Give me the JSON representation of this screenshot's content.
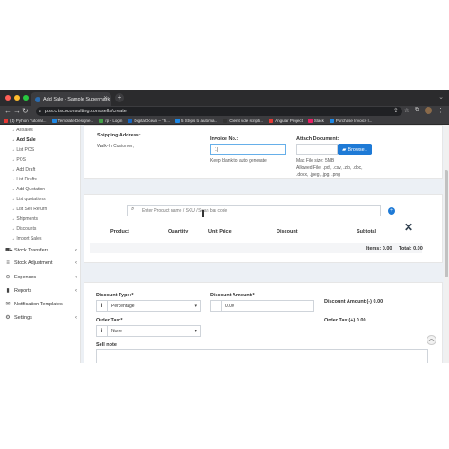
{
  "browser": {
    "tab_title": "Add Sale - Sample Supermark",
    "url": "pos.criscoconsulting.com/sells/create",
    "bookmarks": [
      {
        "label": "(1) Python Tutorial...",
        "color": "#e53935"
      },
      {
        "label": "Template Designe...",
        "color": "#1e88e5"
      },
      {
        "label": "rp - Login",
        "color": "#43a047"
      },
      {
        "label": "DigitalOcean – Th...",
        "color": "#1565c0"
      },
      {
        "label": "5 Steps to automa...",
        "color": "#1e88e5"
      },
      {
        "label": "Client side scripti...",
        "color": "#333333"
      },
      {
        "label": "Angular Project",
        "color": "#e53935"
      },
      {
        "label": "Slack",
        "color": "#e91e63"
      },
      {
        "label": "Purchase Invoice l...",
        "color": "#1e88e5"
      }
    ]
  },
  "sidebar": {
    "sub_items": [
      "→ All sales",
      "→ Add Sale",
      "→ List POS",
      "→ POS",
      "→ Add Draft",
      "→ List Drafts",
      "→ Add Quotation",
      "→ List quotations",
      "→ List Sell Return",
      "→ Shipments",
      "→ Discounts",
      "→ Import Sales"
    ],
    "active_index": 1,
    "main_items": [
      {
        "label": "Stock Transfers",
        "icon": "truck-icon",
        "glyph": "⛟",
        "has_chevron": true
      },
      {
        "label": "Stock Adjustment",
        "icon": "database-icon",
        "glyph": "≡",
        "has_chevron": true
      },
      {
        "label": "Expenses",
        "icon": "minus-circle-icon",
        "glyph": "⊖",
        "has_chevron": true
      },
      {
        "label": "Reports",
        "icon": "chart-icon",
        "glyph": "▮",
        "has_chevron": true
      },
      {
        "label": "Notification Templates",
        "icon": "envelope-icon",
        "glyph": "✉",
        "has_chevron": false
      },
      {
        "label": "Settings",
        "icon": "gear-icon",
        "glyph": "⚙",
        "has_chevron": true
      }
    ]
  },
  "top_card": {
    "shipping_label": "Shipping Address:",
    "customer": "Walk-In Customer,",
    "invoice_label": "Invoice No.:",
    "invoice_value": "1|",
    "invoice_help": "Keep blank to auto generate",
    "attach_label": "Attach Document:",
    "browse_label": "Browse..",
    "max_size": "Max File size: 5MB",
    "allowed_line1": "Allowed File: .pdf, .csv, .zip, .doc,",
    "allowed_line2": ".docx, .jpeg, .jpg, .png"
  },
  "products": {
    "search_placeholder": "Enter Product name / SKU / Scan bar code",
    "headers": [
      "Product",
      "Quantity",
      "Unit Price",
      "Discount",
      "Subtotal"
    ],
    "items_text": "Items: 0.00",
    "total_text": "Total: 0.00"
  },
  "discount": {
    "type_label": "Discount Type:*",
    "type_value": "Percentage",
    "amount_label": "Discount Amount:*",
    "amount_value": "0.00",
    "amount_summary": "Discount Amount:(-) 0.00",
    "tax_label": "Order Tax:*",
    "tax_value": "None",
    "tax_summary": "Order Tax:(+) 0.00",
    "sell_note_label": "Sell note"
  }
}
